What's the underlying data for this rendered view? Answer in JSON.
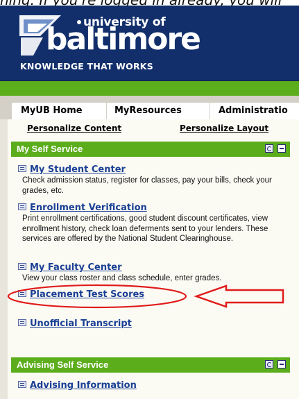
{
  "caption": "hing. If you're logged in already, you will",
  "logo": {
    "university_word": "university of",
    "name": "baltimore",
    "tagline": "KNOWLEDGE THAT WORKS"
  },
  "tabs": [
    {
      "label": "MyUB Home"
    },
    {
      "label": "MyResources"
    },
    {
      "label": "Administratio"
    }
  ],
  "personalize": {
    "content_label": "Personalize Content",
    "layout_label": "Personalize Layout"
  },
  "self_service": {
    "title": "My Self Service",
    "items": [
      {
        "label": "My Student Center",
        "desc": "Check admission status, register for classes, pay your bills, check your grades, etc."
      },
      {
        "label": "Enrollment Verification",
        "desc": "Print enrollment certifications, good student discount certificates, view enrollment history, check loan deferments sent to your lenders. These services are offered by the National Student Clearinghouse."
      },
      {
        "label": "My Faculty Center",
        "desc": "View your class roster and class schedule, enter grades."
      },
      {
        "label": "Placement Test Scores",
        "desc": ""
      },
      {
        "label": "Unofficial Transcript",
        "desc": ""
      }
    ]
  },
  "advising": {
    "title": "Advising Self Service",
    "items": [
      {
        "label": "Advising Information"
      }
    ]
  },
  "colors": {
    "banner": "#122f6b",
    "green": "#5cad1c",
    "link": "#1a3f95",
    "annotation": "#e01b1b"
  }
}
